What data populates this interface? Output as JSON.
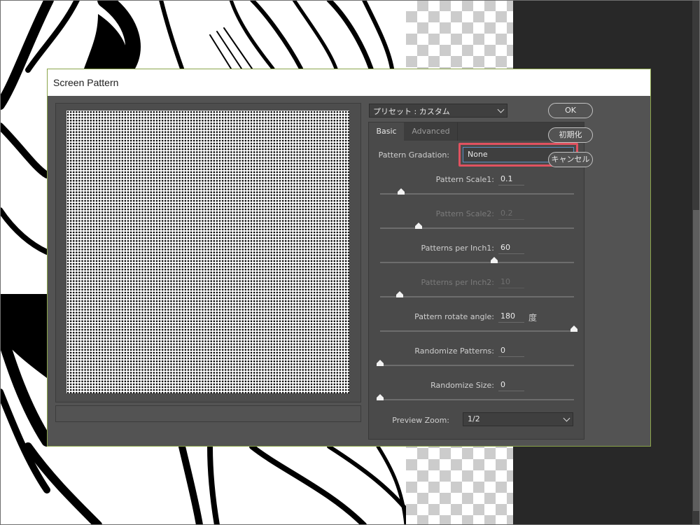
{
  "dialog": {
    "title": "Screen Pattern",
    "preset": "プリセット : カスタム",
    "tabs": [
      {
        "label": "Basic",
        "active": true
      },
      {
        "label": "Advanced",
        "active": false
      }
    ],
    "pattern_gradation": {
      "label": "Pattern Gradation:",
      "value": "None"
    },
    "rows": [
      {
        "label": "Pattern Scale1:",
        "value": "0.1",
        "enabled": true,
        "slider_fraction": 0.11
      },
      {
        "label": "Pattern Scale2:",
        "value": "0.2",
        "enabled": false,
        "slider_fraction": 0.2
      },
      {
        "label": "Patterns per Inch1:",
        "value": "60",
        "enabled": true,
        "slider_fraction": 0.59
      },
      {
        "label": "Patterns per Inch2:",
        "value": "10",
        "enabled": false,
        "slider_fraction": 0.1
      },
      {
        "label": "Pattern rotate angle:",
        "value": "180",
        "unit": "度",
        "enabled": true,
        "slider_fraction": 1.0
      },
      {
        "label": "Randomize Patterns:",
        "value": "0",
        "enabled": true,
        "slider_fraction": 0.0
      },
      {
        "label": "Randomize Size:",
        "value": "0",
        "enabled": true,
        "slider_fraction": 0.0
      }
    ],
    "preview_zoom": {
      "label": "Preview Zoom:",
      "value": "1/2"
    },
    "buttons": {
      "ok": "OK",
      "reset": "初期化",
      "cancel": "キャンセル"
    }
  },
  "colors": {
    "dialog_bg": "#535353",
    "highlight": "#e05260",
    "focus_border": "#5b8fc2"
  }
}
